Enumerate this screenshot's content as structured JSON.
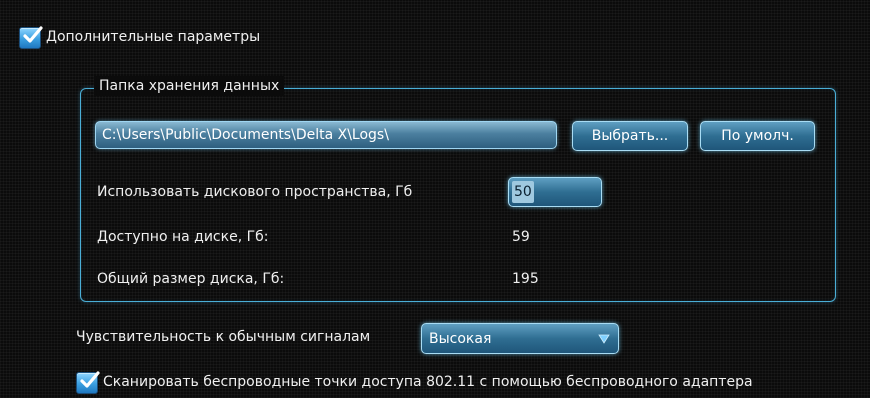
{
  "advanced": {
    "checkbox_label": "Дополнительные параметры",
    "checked": true
  },
  "storage": {
    "group_title": "Папка хранения данных",
    "path_value": "C:\\Users\\Public\\Documents\\Delta X\\Logs\\",
    "browse_label": "Выбрать...",
    "default_label": "По умолч.",
    "disk_usage_label": "Использовать дискового пространства, Гб",
    "disk_usage_value": "50",
    "available_label": "Доступно на диске, Гб:",
    "available_value": "59",
    "total_label": "Общий размер диска, Гб:",
    "total_value": "195"
  },
  "sensitivity": {
    "label": "Чувствительность к обычным сигналам",
    "selected": "Высокая"
  },
  "wireless": {
    "checkbox_label": "Сканировать беспроводные точки доступа 802.11 с помощью беспроводного адаптера",
    "checked": true
  },
  "icons": {
    "check": "check-icon",
    "dropdown": "chevron-down-icon"
  },
  "colors": {
    "accent": "#4aaed6",
    "background": "#0b0b0b",
    "field": "#2f6e92"
  }
}
